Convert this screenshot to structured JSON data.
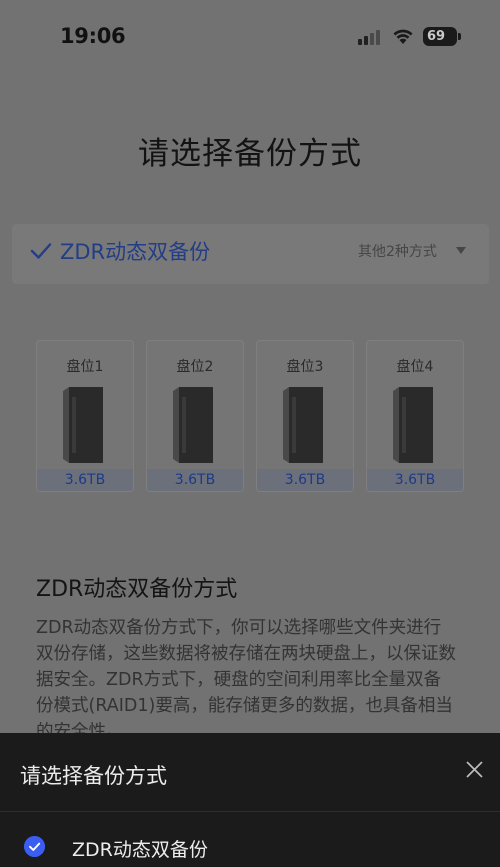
{
  "status_bar": {
    "time": "19:06",
    "battery_level": "69"
  },
  "page": {
    "title": "请选择备份方式"
  },
  "mode_selector": {
    "selected_label": "ZDR动态双备份",
    "other_label": "其他2种方式"
  },
  "slots": [
    {
      "label": "盘位1",
      "capacity": "3.6TB"
    },
    {
      "label": "盘位2",
      "capacity": "3.6TB"
    },
    {
      "label": "盘位3",
      "capacity": "3.6TB"
    },
    {
      "label": "盘位4",
      "capacity": "3.6TB"
    }
  ],
  "section": {
    "title": "ZDR动态双备份方式",
    "description": "ZDR动态双备份方式下，你可以选择哪些文件夹进行双份存储，这些数据将被存储在两块硬盘上，以保证数据安全。ZDR方式下，硬盘的空间利用率比全量双备份模式(RAID1)要高，能存储更多的数据，也具备相当的安全性。"
  },
  "sheet": {
    "title": "请选择备份方式",
    "options": [
      {
        "label": "ZDR动态双备份",
        "selected": true
      }
    ]
  },
  "colors": {
    "accent": "#3b5ef0",
    "selected_text": "#233d86",
    "sheet_bg": "#1b1b1b",
    "overlay_bg": "#727272"
  },
  "icons": {
    "check": "check-icon",
    "caret": "caret-down-icon",
    "close": "close-icon",
    "radio": "radio-checked-icon",
    "disk": "hard-drive-icon"
  }
}
